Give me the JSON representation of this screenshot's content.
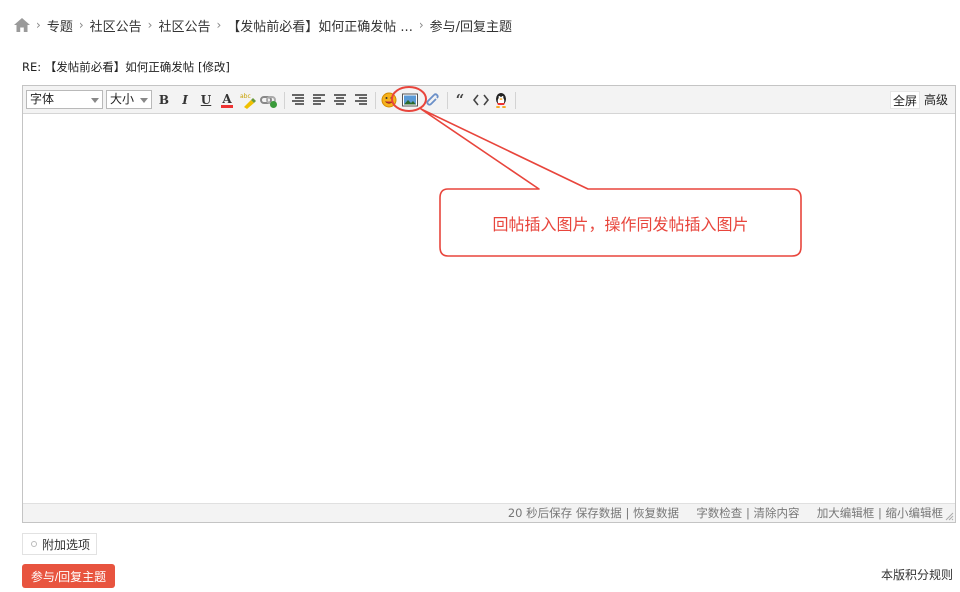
{
  "breadcrumb": {
    "items": [
      "专题",
      "社区公告",
      "社区公告",
      "【发帖前必看】如何正确发帖 ...",
      "参与/回复主题"
    ]
  },
  "subject": {
    "text": "RE: 【发帖前必看】如何正确发帖 [修改]"
  },
  "toolbar": {
    "font_select": "字体",
    "size_select": "大小",
    "fullscreen_label": "全屏",
    "advanced_label": "高级"
  },
  "statusbar": {
    "autosave": "20 秒后保存",
    "save_data": "保存数据",
    "restore_data": "恢复数据",
    "word_check": "字数检查",
    "clear_content": "清除内容",
    "enlarge": "加大编辑框",
    "shrink": "缩小编辑框",
    "separator": "|"
  },
  "annotation": {
    "text": "回帖插入图片，操作同发帖插入图片",
    "color": "#e8453c"
  },
  "footer": {
    "extra_options": "附加选项",
    "submit": "参与/回复主题",
    "rules": "本版积分规则"
  },
  "colors": {
    "submit_bg": "#e8543f",
    "annotation": "#e8453c"
  }
}
